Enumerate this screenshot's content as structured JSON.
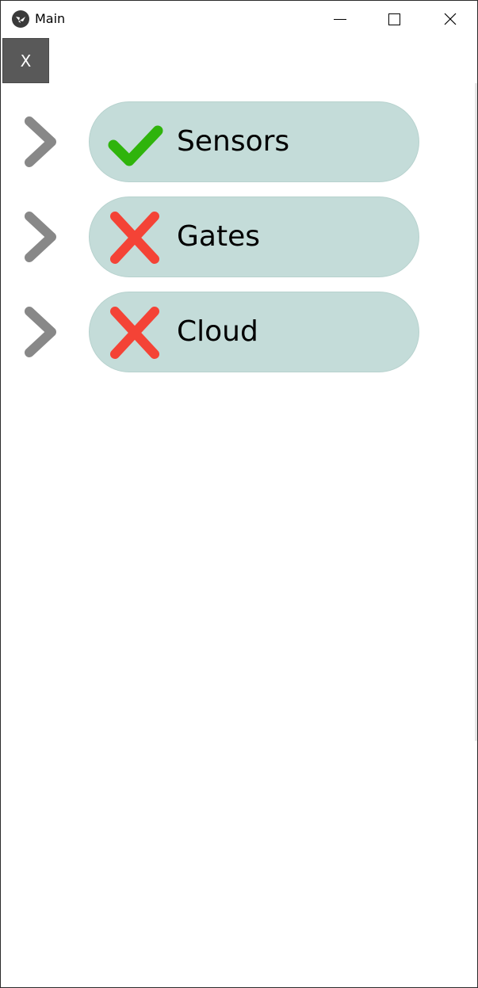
{
  "window": {
    "title": "Main",
    "app_icon": "kivy-logo-icon",
    "controls": [
      "minimize-icon",
      "maximize-icon",
      "close-icon"
    ]
  },
  "toolbar": {
    "close_button_label": "X"
  },
  "items": [
    {
      "label": "Sensors",
      "status": "ok",
      "status_icon": "checkmark-icon",
      "status_color": "#2fb40c"
    },
    {
      "label": "Gates",
      "status": "error",
      "status_icon": "cross-icon",
      "status_color": "#f44336"
    },
    {
      "label": "Cloud",
      "status": "error",
      "status_icon": "cross-icon",
      "status_color": "#f44336"
    }
  ],
  "colors": {
    "pill_background": "#c4dcd9",
    "chevron": "#888888",
    "close_button_background": "#595959"
  }
}
